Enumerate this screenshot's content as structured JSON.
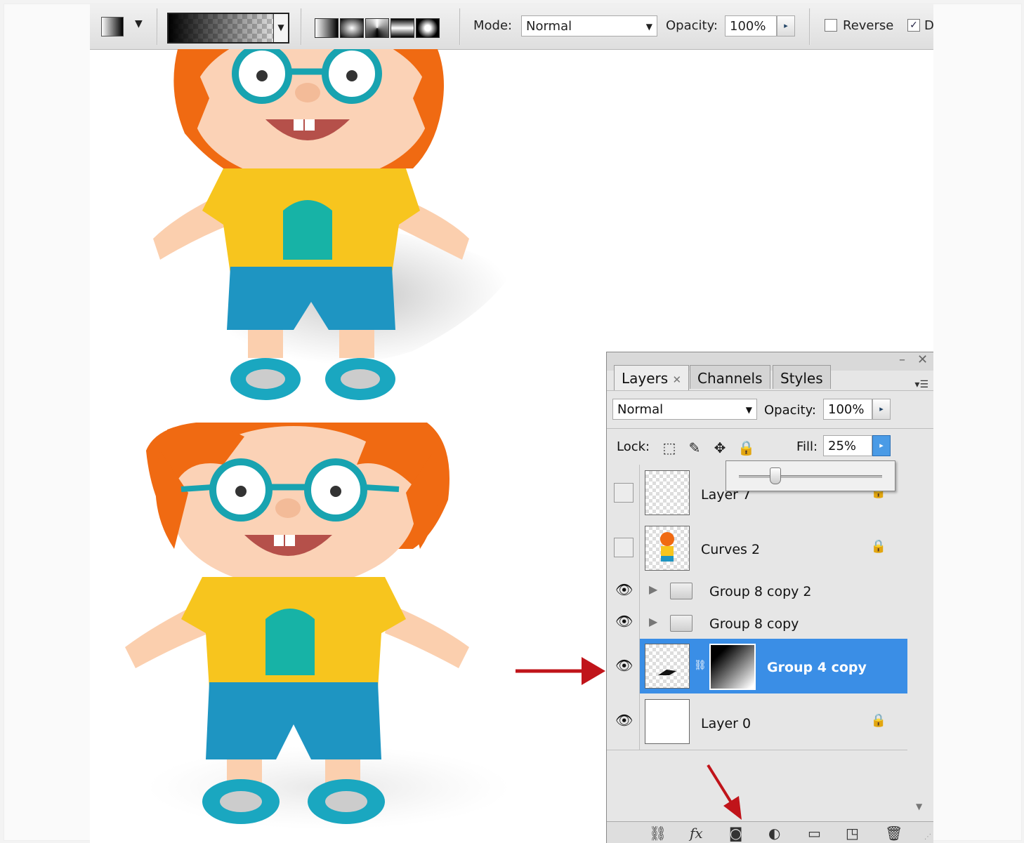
{
  "options_bar": {
    "mode_label": "Mode:",
    "mode_value": "Normal",
    "opacity_label": "Opacity:",
    "opacity_value": "100%",
    "reverse_label": "Reverse",
    "dither_label": "D"
  },
  "layers_panel": {
    "tabs": [
      {
        "label": "Layers"
      },
      {
        "label": "Channels"
      },
      {
        "label": "Styles"
      }
    ],
    "blend_mode": "Normal",
    "opacity_label": "Opacity:",
    "opacity_value": "100%",
    "lock_label": "Lock:",
    "fill_label": "Fill:",
    "fill_value": "25%",
    "fill_slider_fraction": 0.25,
    "layers": [
      {
        "name": "Layer 7",
        "visible": false,
        "locked": true,
        "kind": "layer"
      },
      {
        "name": "Curves 2",
        "visible": false,
        "locked": true,
        "kind": "layer"
      },
      {
        "name": "Group 8 copy 2",
        "visible": true,
        "locked": false,
        "kind": "group"
      },
      {
        "name": "Group 8 copy",
        "visible": true,
        "locked": false,
        "kind": "group"
      },
      {
        "name": "Group 4 copy",
        "visible": true,
        "locked": false,
        "kind": "masked",
        "selected": true
      },
      {
        "name": "Layer 0",
        "visible": true,
        "locked": true,
        "kind": "layer"
      }
    ]
  },
  "colors": {
    "selection": "#3a8ee6",
    "annotation_arrow": "#c0141a",
    "hair": "#f06a12",
    "shirt": "#f7c51e",
    "shorts": "#1e95c2",
    "glasses": "#18a3b0"
  },
  "icons": [
    "gradient-tool-icon",
    "eye-icon",
    "lock-icon",
    "folder-icon",
    "link-icon",
    "fx-icon",
    "mask-icon",
    "adjustment-icon",
    "new-group-icon",
    "new-layer-icon",
    "trash-icon"
  ]
}
